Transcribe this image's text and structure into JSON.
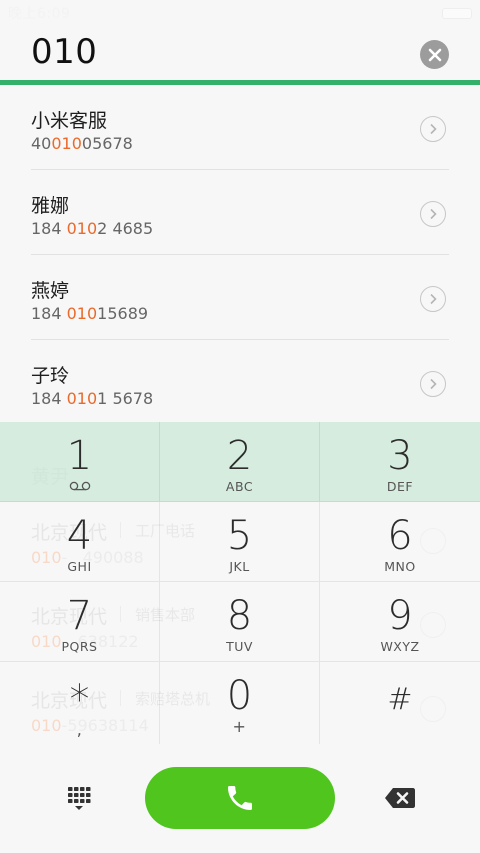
{
  "status_bar": {
    "time": "晚上6:09"
  },
  "dialer": {
    "input_value": "010"
  },
  "contacts": [
    {
      "name": "小米客服",
      "number_pre": "40",
      "number_match": "010",
      "number_post": "05678"
    },
    {
      "name": "雅娜",
      "number_pre": "184 ",
      "number_match": "010",
      "number_post": "2 4685"
    },
    {
      "name": "燕婷",
      "number_pre": "184 ",
      "number_match": "010",
      "number_post": "15689"
    },
    {
      "name": "子玲",
      "number_pre": "184 ",
      "number_match": "010",
      "number_post": "1 5678"
    }
  ],
  "background_contacts": [
    {
      "name": "黄尹",
      "label": "",
      "number_pre": "",
      "number_match": "",
      "number_post": ""
    },
    {
      "name": "北京现代",
      "label": "工厂电话",
      "number_pre": "",
      "number_match": "010",
      "number_post": "-   490088"
    },
    {
      "name": "北京现代",
      "label": "销售本部",
      "number_pre": "",
      "number_match": "010",
      "number_post": "-  638122"
    },
    {
      "name": "北京现代",
      "label": "索赔塔总机",
      "number_pre": "",
      "number_match": "010",
      "number_post": "-59638114"
    }
  ],
  "keypad": {
    "keys": [
      {
        "digit": "1",
        "letters": ""
      },
      {
        "digit": "2",
        "letters": "ABC"
      },
      {
        "digit": "3",
        "letters": "DEF"
      },
      {
        "digit": "4",
        "letters": "GHI"
      },
      {
        "digit": "5",
        "letters": "JKL"
      },
      {
        "digit": "6",
        "letters": "MNO"
      },
      {
        "digit": "7",
        "letters": "PQRS"
      },
      {
        "digit": "8",
        "letters": "TUV"
      },
      {
        "digit": "9",
        "letters": "WXYZ"
      },
      {
        "digit": "*",
        "letters": ","
      },
      {
        "digit": "0",
        "letters": "+"
      },
      {
        "digit": "#",
        "letters": ""
      }
    ]
  },
  "icons": {
    "clear": "close-icon",
    "detail": "chevron-right-icon",
    "voicemail": "voicemail-icon",
    "keypad_toggle": "dialpad-icon",
    "call": "phone-icon",
    "backspace": "backspace-icon"
  },
  "colors": {
    "accent": "#33b06a",
    "match_highlight": "#e96a2b",
    "call_button": "#4fc51e",
    "keypad_highlight": "#c8e8d6"
  }
}
